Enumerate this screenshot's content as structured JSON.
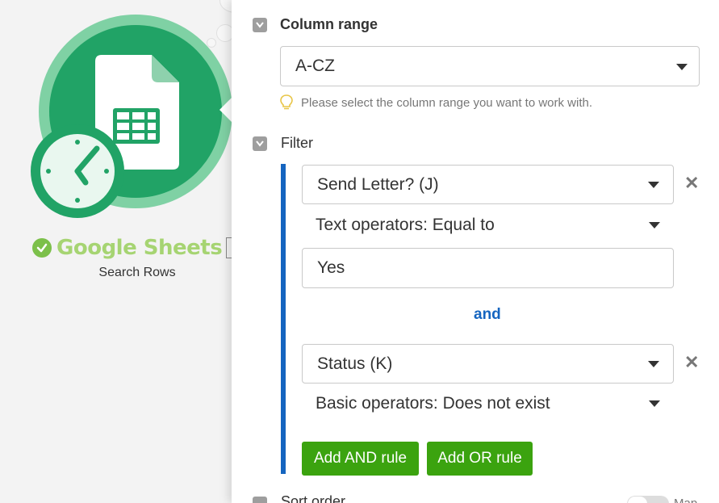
{
  "scenario": {
    "module": {
      "app_name": "Google Sheets",
      "action": "Search Rows",
      "brand_color": "#21a366",
      "ring_color": "#7fd1a4",
      "status_color": "#7cc04a",
      "icons": [
        "google-sheets-icon",
        "clock-icon",
        "check-icon"
      ]
    }
  },
  "panel": {
    "column_range": {
      "label": "Column range",
      "value": "A-CZ",
      "hint": "Please select the column range you want to work with.",
      "hint_icon": "lightbulb-icon"
    },
    "filter": {
      "label": "Filter",
      "accent_color": "#1565c0",
      "rules": [
        {
          "field": "Send Letter? (J)",
          "operator": "Text operators: Equal to",
          "value": "Yes"
        },
        {
          "field": "Status (K)",
          "operator": "Basic operators: Does not exist"
        }
      ],
      "joiner": "and",
      "add_and_label": "Add AND rule",
      "add_or_label": "Add OR rule",
      "button_color": "#3ba30f"
    },
    "sort_order": {
      "label": "Sort order",
      "toggle_text": "Map"
    }
  }
}
